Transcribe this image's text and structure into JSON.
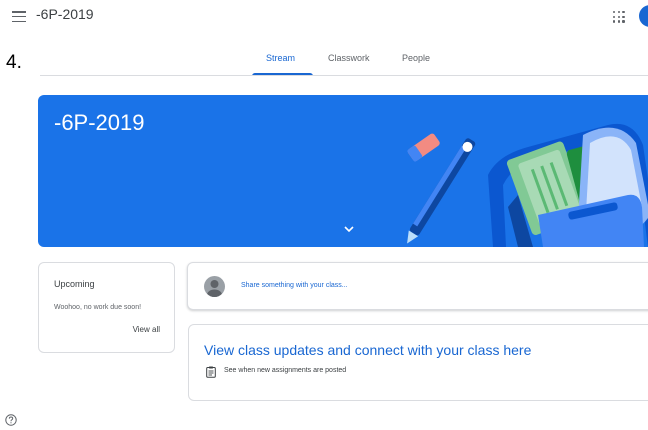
{
  "header": {
    "class_title": "-6P-2019"
  },
  "annotation": {
    "step_number": "4."
  },
  "tabs": [
    {
      "label": "Stream",
      "active": true
    },
    {
      "label": "Classwork",
      "active": false
    },
    {
      "label": "People",
      "active": false
    }
  ],
  "banner": {
    "title": "-6P-2019",
    "color": "#1a73e8"
  },
  "upcoming": {
    "title": "Upcoming",
    "empty_text": "Woohoo, no work due soon!",
    "view_all_label": "View all"
  },
  "stream": {
    "share_placeholder": "Share something with your class...",
    "info_heading": "View class updates and connect with your class here",
    "info_subtext": "See when new assignments are posted"
  },
  "icons": {
    "menu": "menu-icon",
    "apps": "apps-grid-icon",
    "help": "help-icon",
    "chevron": "chevron-down-icon",
    "assignment": "assignment-icon"
  },
  "colors": {
    "accent": "#1967d2",
    "banner": "#1a73e8"
  }
}
